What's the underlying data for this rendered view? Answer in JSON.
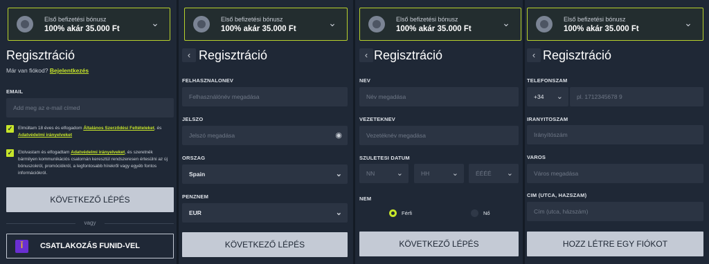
{
  "bonus": {
    "line1": "Első befizetési bónusz",
    "line2": "100% akár 35.000 Ft"
  },
  "icons": {
    "bonus": "soccer-ball-icon",
    "chevron": "chevron-down-icon",
    "back": "chevron-left-icon",
    "eye": "eye-icon"
  },
  "panel1": {
    "title": "Regisztráció",
    "have_account": "Már van fiókod?",
    "login_link": "Bejelentkezés",
    "email_label": "EMAIL",
    "email_placeholder": "Add meg az e-mail címed",
    "consent1_pre": "Elmúltam 18 éves és elfogadom",
    "consent1_link1": "Általános Szerződési Feltételeket",
    "consent1_mid": ", és",
    "consent1_link2": "Adatvédelmi irányelveket",
    "consent2_pre": "Elolvastam és elfogadtam",
    "consent2_link": "Adatvédelmi irányelveket",
    "consent2_rest": ", és szeretnék bármilyen kommunikációs csatornán keresztül rendszeresen értesülni az új bónuszokról, promóciókról, a legfontosabb hírekről vagy egyéb fontos információkról.",
    "next_button": "KÖVETKEZŐ LÉPÉS",
    "or": "vagy",
    "funid_button": "CSATLAKOZÁS FUNID-VEL"
  },
  "panel2": {
    "title": "Regisztráció",
    "username_label": "FELHASZNALONEV",
    "username_placeholder": "Felhasználónév megadása",
    "password_label": "JELSZO",
    "password_placeholder": "Jelszó megadása",
    "country_label": "ORSZAG",
    "country_value": "Spain",
    "currency_label": "PENZNEM",
    "currency_value": "EUR",
    "next_button": "KÖVETKEZŐ LÉPÉS"
  },
  "panel3": {
    "title": "Regisztráció",
    "name_label": "NEV",
    "name_placeholder": "Név megadása",
    "surname_label": "VEZETEKNEV",
    "surname_placeholder": "Vezetéknév megadása",
    "birth_label": "SZULETESI DATUM",
    "day": "NN",
    "month": "HH",
    "year": "ÉÉÉÉ",
    "gender_label": "NEM",
    "male": "Férfi",
    "female": "Nő",
    "next_button": "KÖVETKEZŐ LÉPÉS"
  },
  "panel4": {
    "title": "Regisztráció",
    "phone_label": "TELEFONSZAM",
    "phone_code": "+34",
    "phone_placeholder": "pl. 1712345678 9",
    "zip_label": "IRANYITOSZAM",
    "zip_placeholder": "Irányítószám",
    "city_label": "VAROS",
    "city_placeholder": "Város megadása",
    "address_label": "CIM (UTCA, HAZSZAM)",
    "address_placeholder": "Cím (utca, házszám)",
    "create_button": "HOZZ LÉTRE EGY FIÓKOT"
  },
  "colors": {
    "accent": "#c7e52a",
    "bg": "#1f2836",
    "field": "#2b3443",
    "button": "#c4cad5"
  }
}
